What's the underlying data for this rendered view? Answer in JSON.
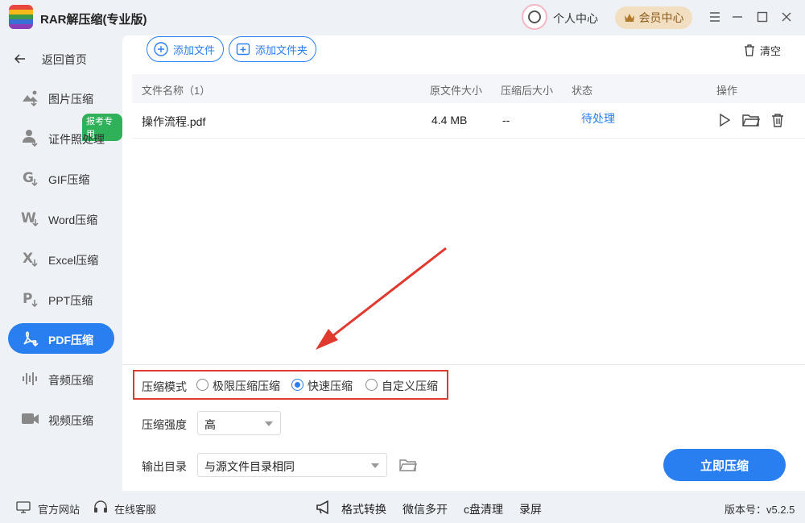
{
  "app": {
    "title": "RAR解压缩(专业版)"
  },
  "header": {
    "user_center": "个人中心",
    "vip_center": "会员中心"
  },
  "sidebar": {
    "back": "返回首页",
    "badge": "报考专用",
    "items": [
      {
        "label": "图片压缩",
        "icon": "image-icon"
      },
      {
        "label": "证件照处理",
        "icon": "id-photo-icon"
      },
      {
        "label": "GIF压缩",
        "icon": "gif-icon"
      },
      {
        "label": "Word压缩",
        "icon": "word-icon"
      },
      {
        "label": "Excel压缩",
        "icon": "excel-icon"
      },
      {
        "label": "PPT压缩",
        "icon": "ppt-icon"
      },
      {
        "label": "PDF压缩",
        "icon": "pdf-icon",
        "active": true
      },
      {
        "label": "音频压缩",
        "icon": "audio-icon"
      },
      {
        "label": "视频压缩",
        "icon": "video-icon"
      }
    ]
  },
  "toolbar": {
    "add_file": "添加文件",
    "add_folder": "添加文件夹",
    "clear": "清空"
  },
  "table": {
    "headers": {
      "name": "文件名称（1）",
      "orig_size": "原文件大小",
      "comp_size": "压缩后大小",
      "status": "状态",
      "action": "操作"
    },
    "rows": [
      {
        "name": "操作流程.pdf",
        "orig_size": "4.4 MB",
        "comp_size": "--",
        "status": "待处理"
      }
    ]
  },
  "settings": {
    "mode_label": "压缩模式",
    "modes": [
      "极限压缩压缩",
      "快速压缩",
      "自定义压缩"
    ],
    "selected_mode": "快速压缩",
    "strength_label": "压缩强度",
    "strength_value": "高",
    "output_label": "输出目录",
    "output_value": "与源文件目录相同"
  },
  "actions": {
    "compress_now": "立即压缩"
  },
  "footer": {
    "website": "官方网站",
    "support": "在线客服",
    "tools": [
      "格式转换",
      "微信多开",
      "c盘清理",
      "录屏"
    ],
    "version": "版本号：v5.2.5"
  },
  "colors": {
    "accent": "#2a7ff0",
    "highlight": "#e03a2f",
    "vip": "#f2dfc1"
  }
}
